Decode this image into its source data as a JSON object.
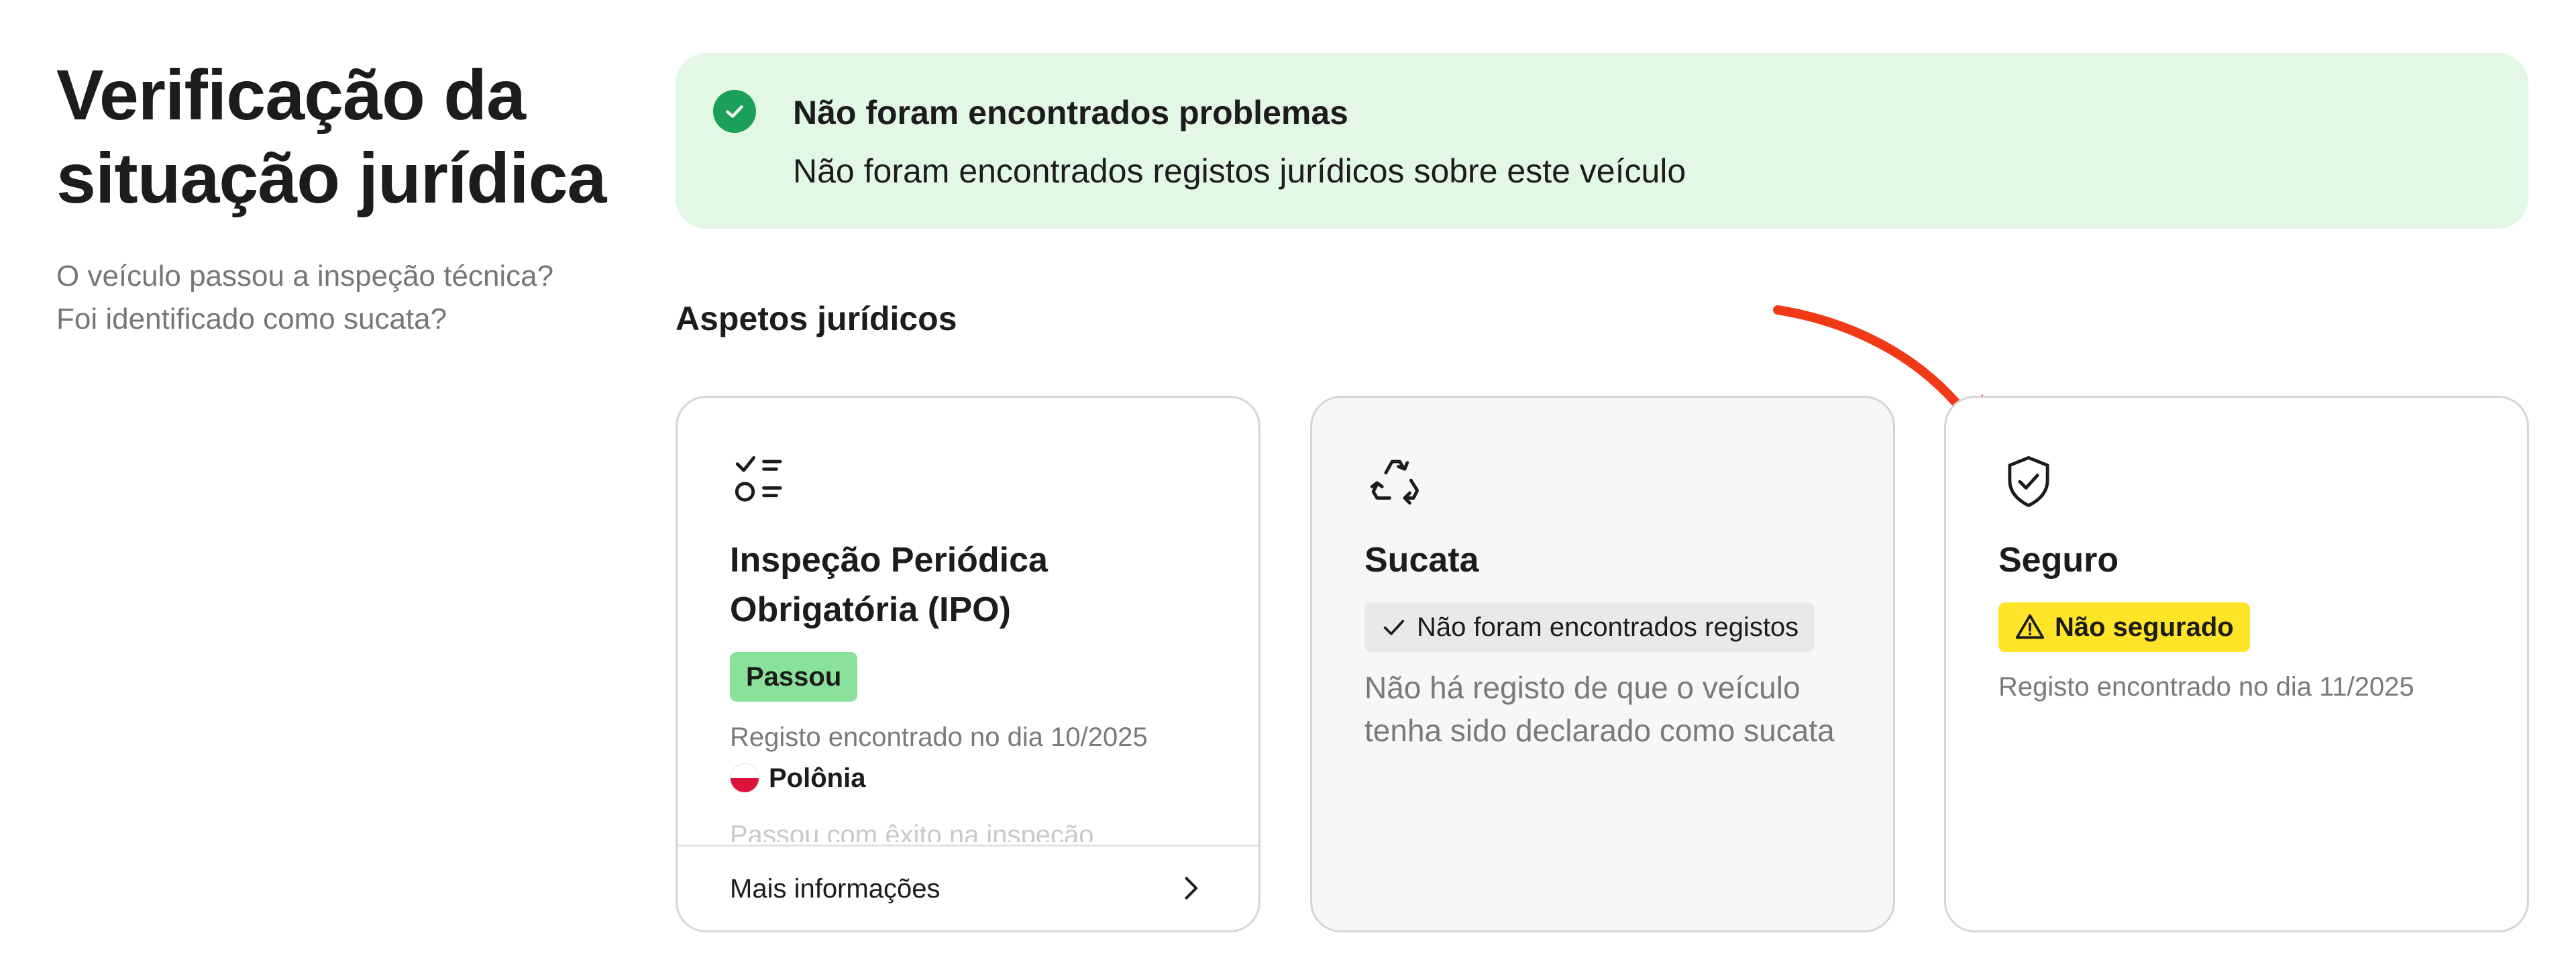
{
  "left": {
    "title": "Verificação da situação jurídica",
    "subtitle_line1": "O veículo passou a inspeção técnica?",
    "subtitle_line2": "Foi identificado como sucata?"
  },
  "banner": {
    "title": "Não foram encontrados problemas",
    "text": "Não foram encontrados registos jurídicos sobre este veículo",
    "icon": "check-circle-icon",
    "color": "#e2f8e5"
  },
  "section": {
    "heading": "Aspetos jurídicos"
  },
  "cards": [
    {
      "icon": "checklist-icon",
      "title": "Inspeção Periódica Obrigatória (IPO)",
      "badge": "Passou",
      "meta": "Registo encontrado no dia 10/2025",
      "country": "Polônia",
      "detail": "Passou com êxito na inspeção",
      "footer_link": "Mais informações",
      "badge_color": "#8ae19a"
    },
    {
      "icon": "recycle-icon",
      "title": "Sucata",
      "badge": "Não foram encontrados registos",
      "description": "Não há registo de que o veículo tenha sido declarado como sucata"
    },
    {
      "icon": "shield-check-icon",
      "title": "Seguro",
      "badge": "Não segurado",
      "meta": "Registo encontrado no dia 11/2025",
      "badge_color": "#ffe427"
    }
  ],
  "annotation": {
    "arrow_color": "#f03a17"
  }
}
